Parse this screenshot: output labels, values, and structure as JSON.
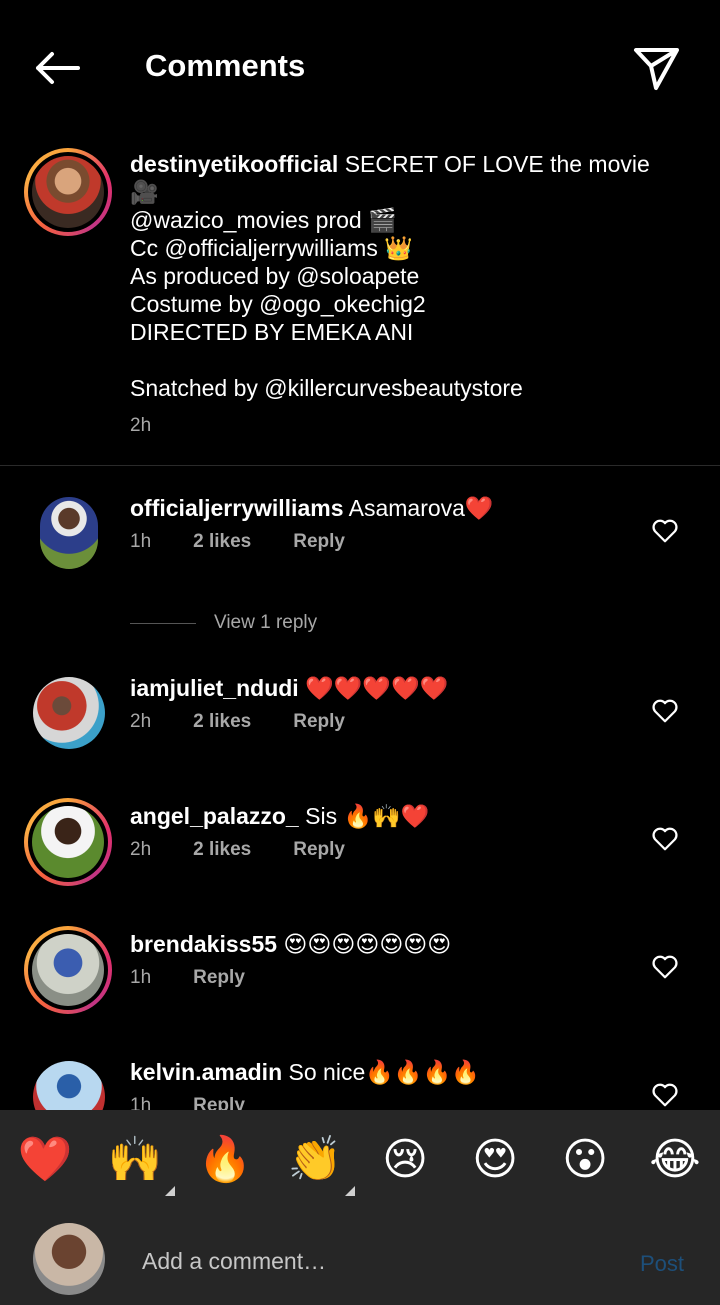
{
  "header": {
    "title": "Comments"
  },
  "caption": {
    "username": "destinyetikoofficial",
    "first_line": "SECRET OF LOVE the movie",
    "lines": [
      "🎥",
      "@wazico_movies prod 🎬",
      "Cc @officialjerrywilliams 👑",
      "As produced by @soloapete",
      "Costume by @ogo_okechig2",
      "DIRECTED BY EMEKA ANI",
      "",
      "Snatched by @killercurvesbeautystore"
    ],
    "time": "2h"
  },
  "comments": [
    {
      "username": "officialjerrywilliams",
      "text": "Asamarova❤️",
      "time": "1h",
      "likes": "2 likes",
      "reply": "Reply"
    },
    {
      "username": "iamjuliet_ndudi",
      "text": "❤️❤️❤️❤️❤️",
      "time": "2h",
      "likes": "2 likes",
      "reply": "Reply"
    },
    {
      "username": "angel_palazzo_",
      "text": "Sis 🔥🙌❤️",
      "time": "2h",
      "likes": "2 likes",
      "reply": "Reply"
    },
    {
      "username": "brendakiss55",
      "text": "😍😍😍😍😍😍😍",
      "time": "1h",
      "reply": "Reply"
    },
    {
      "username": "kelvin.amadin",
      "text": "So nice🔥🔥🔥🔥",
      "time": "1h",
      "reply": "Reply"
    }
  ],
  "view_replies": "View 1 reply",
  "emoji_bar": [
    "❤️",
    "🙌",
    "🔥",
    "👏",
    "😢",
    "😍",
    "😮",
    "😂"
  ],
  "composer": {
    "placeholder": "Add a comment…",
    "post_label": "Post"
  },
  "colors": {
    "background": "#000000",
    "secondary_text": "#a8a8a8",
    "bar": "#262626",
    "post_disabled": "#1d4f7a",
    "story_ring": "#e1306c"
  }
}
